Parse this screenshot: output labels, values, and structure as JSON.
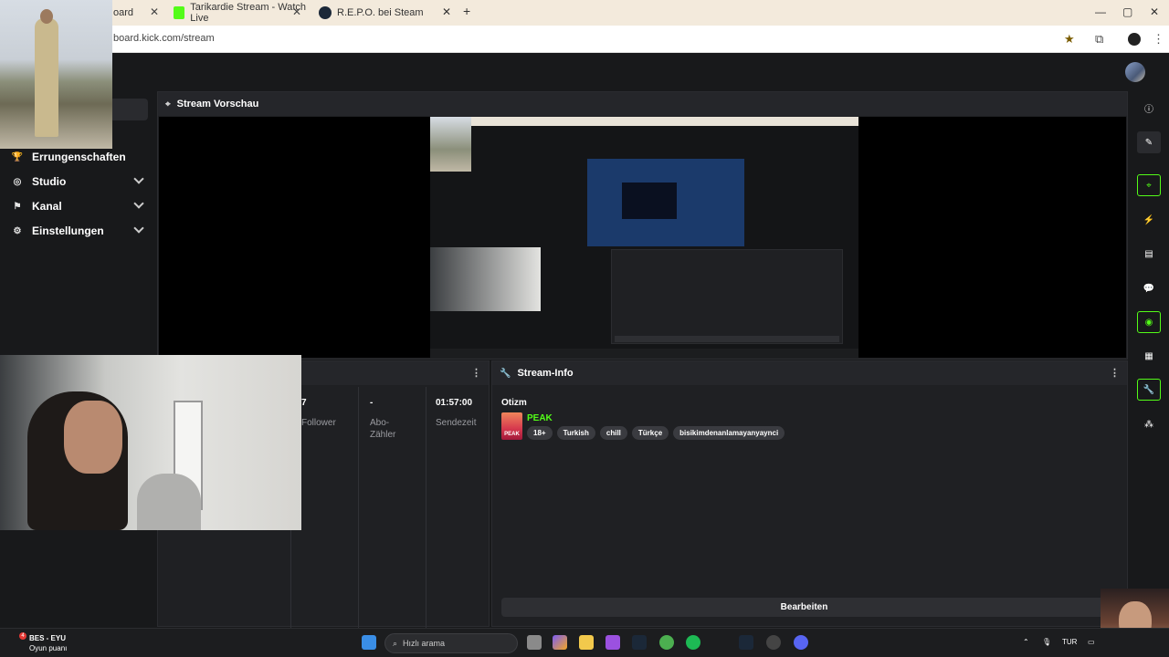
{
  "browser": {
    "tabs": [
      {
        "label": "oard",
        "active": true
      },
      {
        "label": "Tarikardie Stream - Watch Live",
        "active": false
      },
      {
        "label": "R.E.P.O. bei Steam",
        "active": false
      }
    ],
    "new_tab": "+",
    "url": "board.kick.com/stream",
    "controls": {
      "minimize": "—",
      "maximize": "▢",
      "close": "✕"
    }
  },
  "sidebar": {
    "items": [
      {
        "label": "Errungenschaften",
        "icon": "trophy-icon"
      },
      {
        "label": "Studio",
        "icon": "studio-icon"
      },
      {
        "label": "Kanal",
        "icon": "channel-icon"
      },
      {
        "label": "Einstellungen",
        "icon": "gear-icon"
      }
    ]
  },
  "preview": {
    "title": "Stream Vorschau"
  },
  "stats": {
    "columns": [
      {
        "value": "7",
        "label": "Follower"
      },
      {
        "value": "-",
        "label": "Abo-\nZähler"
      },
      {
        "value": "01:57:00",
        "label": "Sendezeit"
      }
    ]
  },
  "stream_info": {
    "title": "Stream-Info",
    "stream_title": "Otizm",
    "game": "PEAK",
    "game_thumb_text": "PEAK",
    "tags": [
      "18+",
      "Turkish",
      "chill",
      "Türkçe",
      "bisikimdenanlamayanyaynci"
    ],
    "edit_label": "Bearbeiten"
  },
  "right_toolbar": [
    {
      "icon": "info-icon",
      "active": false
    },
    {
      "icon": "pencil-icon",
      "active": false
    },
    {
      "icon": "preview-icon",
      "active": true
    },
    {
      "icon": "lightning-icon",
      "active": false
    },
    {
      "icon": "document-icon",
      "active": false
    },
    {
      "icon": "chat-icon",
      "active": false
    },
    {
      "icon": "broadcast-icon",
      "active": true
    },
    {
      "icon": "layout-icon",
      "active": false
    },
    {
      "icon": "wrench-icon",
      "active": true
    },
    {
      "icon": "apps-icon",
      "active": false
    }
  ],
  "taskbar": {
    "weather_title": "BES - EYU",
    "weather_sub": "Oyun puanı",
    "notification_count": "4",
    "search_placeholder": "Hızlı arama",
    "language": "TUR"
  },
  "colors": {
    "accent": "#53fc18",
    "background": "#18191b",
    "panel": "#1f2023"
  }
}
